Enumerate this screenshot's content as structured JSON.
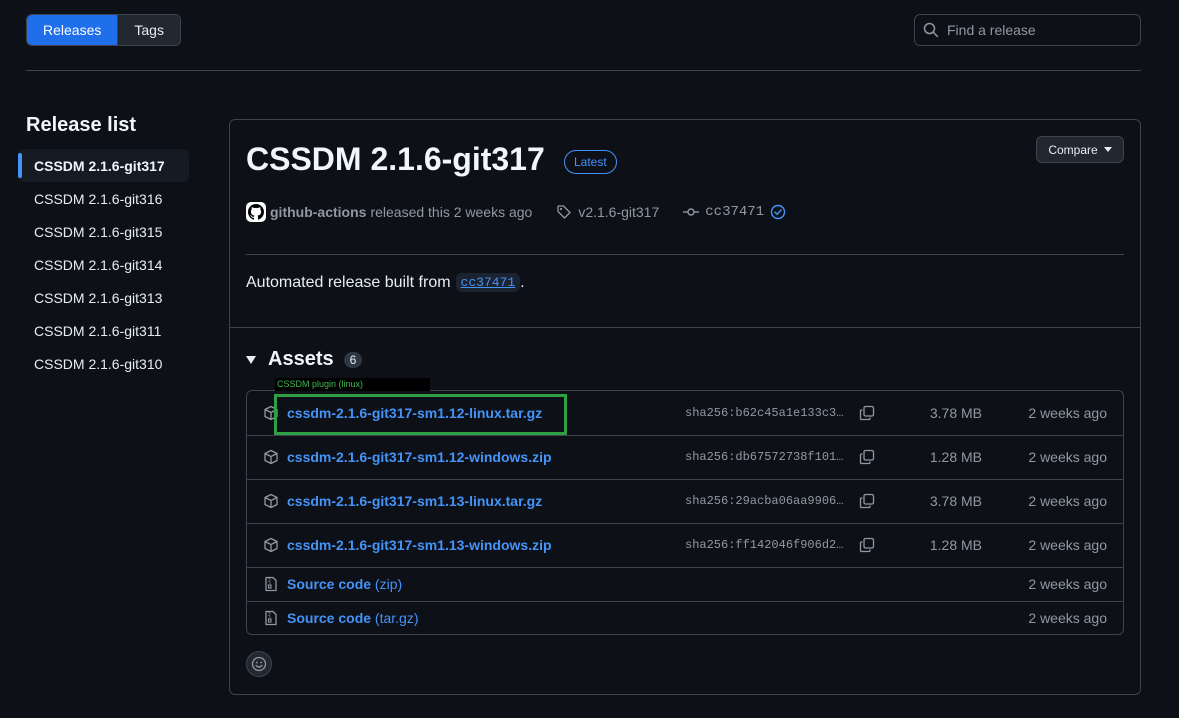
{
  "tabs": [
    {
      "label": "Releases",
      "active": true
    },
    {
      "label": "Tags",
      "active": false
    }
  ],
  "search": {
    "placeholder": "Find a release",
    "value": ""
  },
  "sidebar": {
    "title": "Release list",
    "items": [
      {
        "label": "CSSDM 2.1.6-git317",
        "active": true
      },
      {
        "label": "CSSDM 2.1.6-git316"
      },
      {
        "label": "CSSDM 2.1.6-git315"
      },
      {
        "label": "CSSDM 2.1.6-git314"
      },
      {
        "label": "CSSDM 2.1.6-git313"
      },
      {
        "label": "CSSDM 2.1.6-git311"
      },
      {
        "label": "CSSDM 2.1.6-git310"
      }
    ]
  },
  "release": {
    "title": "CSSDM 2.1.6-git317",
    "badge": "Latest",
    "compare_label": "Compare",
    "author": "github-actions",
    "released_text": "released this 2 weeks ago",
    "tag": "v2.1.6-git317",
    "commit": "cc37471",
    "body_prefix": "Automated release built from",
    "body_commit": "cc37471",
    "body_suffix": "."
  },
  "assets": {
    "title": "Assets",
    "count": "6",
    "tooltip": "CSSDM plugin (linux)",
    "files": [
      {
        "name": "cssdm-2.1.6-git317-sm1.12-linux.tar.gz",
        "sha": "sha256:b62c45a1e133c3…",
        "size": "3.78 MB",
        "when": "2 weeks ago"
      },
      {
        "name": "cssdm-2.1.6-git317-sm1.12-windows.zip",
        "sha": "sha256:db67572738f101…",
        "size": "1.28 MB",
        "when": "2 weeks ago"
      },
      {
        "name": "cssdm-2.1.6-git317-sm1.13-linux.tar.gz",
        "sha": "sha256:29acba06aa9906…",
        "size": "3.78 MB",
        "when": "2 weeks ago"
      },
      {
        "name": "cssdm-2.1.6-git317-sm1.13-windows.zip",
        "sha": "sha256:ff142046f906d2…",
        "size": "1.28 MB",
        "when": "2 weeks ago"
      }
    ],
    "source": [
      {
        "name": "Source code",
        "suffix": "(zip)",
        "when": "2 weeks ago"
      },
      {
        "name": "Source code",
        "suffix": "(tar.gz)",
        "when": "2 weeks ago"
      }
    ]
  },
  "colors": {
    "accent": "#4493f8",
    "active_tab": "#1f6feb",
    "highlight": "#2ea043"
  },
  "icons": [
    "search-icon",
    "github-avatar-icon",
    "tag-icon",
    "commit-icon",
    "verified-icon",
    "triangle-down-icon",
    "package-icon",
    "copy-icon",
    "file-zip-icon",
    "smiley-icon",
    "caret-down-icon"
  ]
}
